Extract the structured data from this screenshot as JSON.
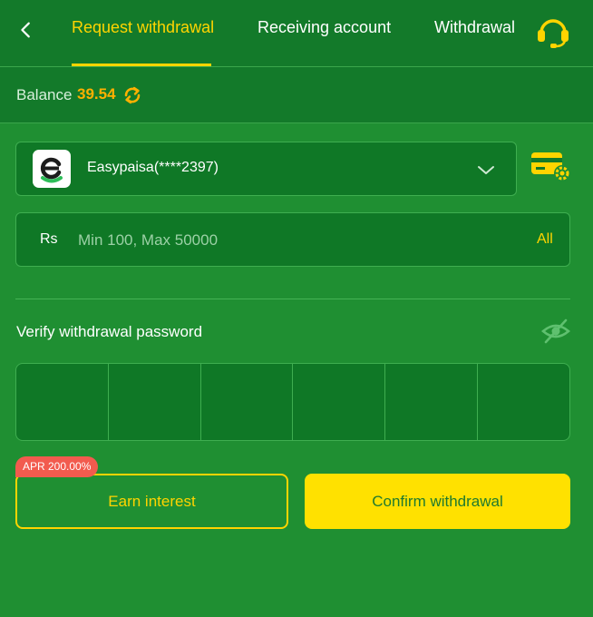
{
  "header": {
    "tabs": [
      {
        "label": "Request withdrawal",
        "active": true
      },
      {
        "label": "Receiving account",
        "active": false
      },
      {
        "label": "Withdrawal",
        "active": false
      }
    ],
    "back_icon": "chevron-left-icon",
    "support_icon": "headset-icon"
  },
  "balance": {
    "label": "Balance",
    "value": "39.54",
    "refresh_icon": "refresh-icon"
  },
  "account": {
    "name": "Easypaisa(****2397)",
    "logo_icon": "easypaisa-logo",
    "dropdown_icon": "chevron-down-icon",
    "settings_icon": "card-settings-icon"
  },
  "amount": {
    "currency_label": "Rs",
    "placeholder": "Min 100, Max 50000",
    "value": "",
    "all_label": "All"
  },
  "password": {
    "label": "Verify withdrawal password",
    "toggle_icon": "eye-off-icon",
    "length": 6
  },
  "actions": {
    "apr_badge": "APR 200.00%",
    "earn_label": "Earn interest",
    "confirm_label": "Confirm withdrawal"
  },
  "colors": {
    "background": "#1f8f32",
    "header": "#137a2a",
    "accent": "#ffd400",
    "balance": "#ffb000",
    "badge": "#f25b4e"
  }
}
